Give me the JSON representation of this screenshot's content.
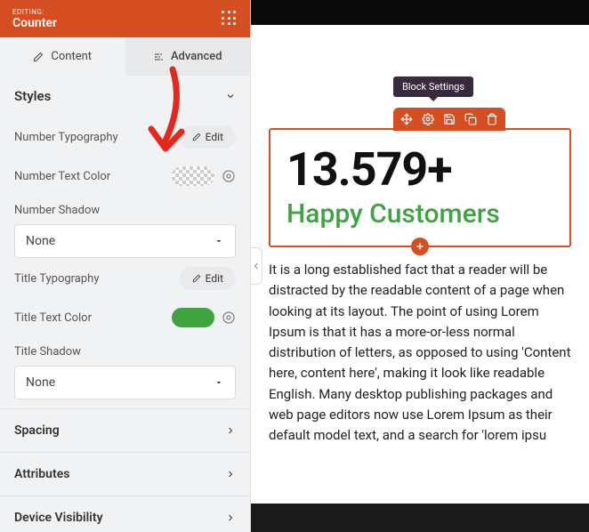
{
  "header": {
    "editing": "EDITING:",
    "title": "Counter"
  },
  "tabs": {
    "content": "Content",
    "advanced": "Advanced"
  },
  "styles": {
    "heading": "Styles",
    "number_typography": "Number Typography",
    "number_text_color": "Number Text Color",
    "number_shadow": "Number Shadow",
    "title_typography": "Title Typography",
    "title_text_color": "Title Text Color",
    "title_shadow": "Title Shadow",
    "edit": "Edit",
    "none": "None",
    "title_color_value": "#3fa33f"
  },
  "sections": {
    "spacing": "Spacing",
    "attributes": "Attributes",
    "device_visibility": "Device Visibility"
  },
  "preview": {
    "tooltip": "Block Settings",
    "number": "13.579+",
    "subtitle": "Happy Customers",
    "body": "It is a long established fact that a reader will be distracted by the readable content of a page when looking at its layout. The point of using Lorem Ipsum is that it has a more-or-less normal distribution of letters, as opposed to using 'Content here, content here', making it look like readable English. Many desktop publishing packages and web page editors now use Lorem Ipsum as their default model text, and a search for 'lorem ipsu"
  }
}
